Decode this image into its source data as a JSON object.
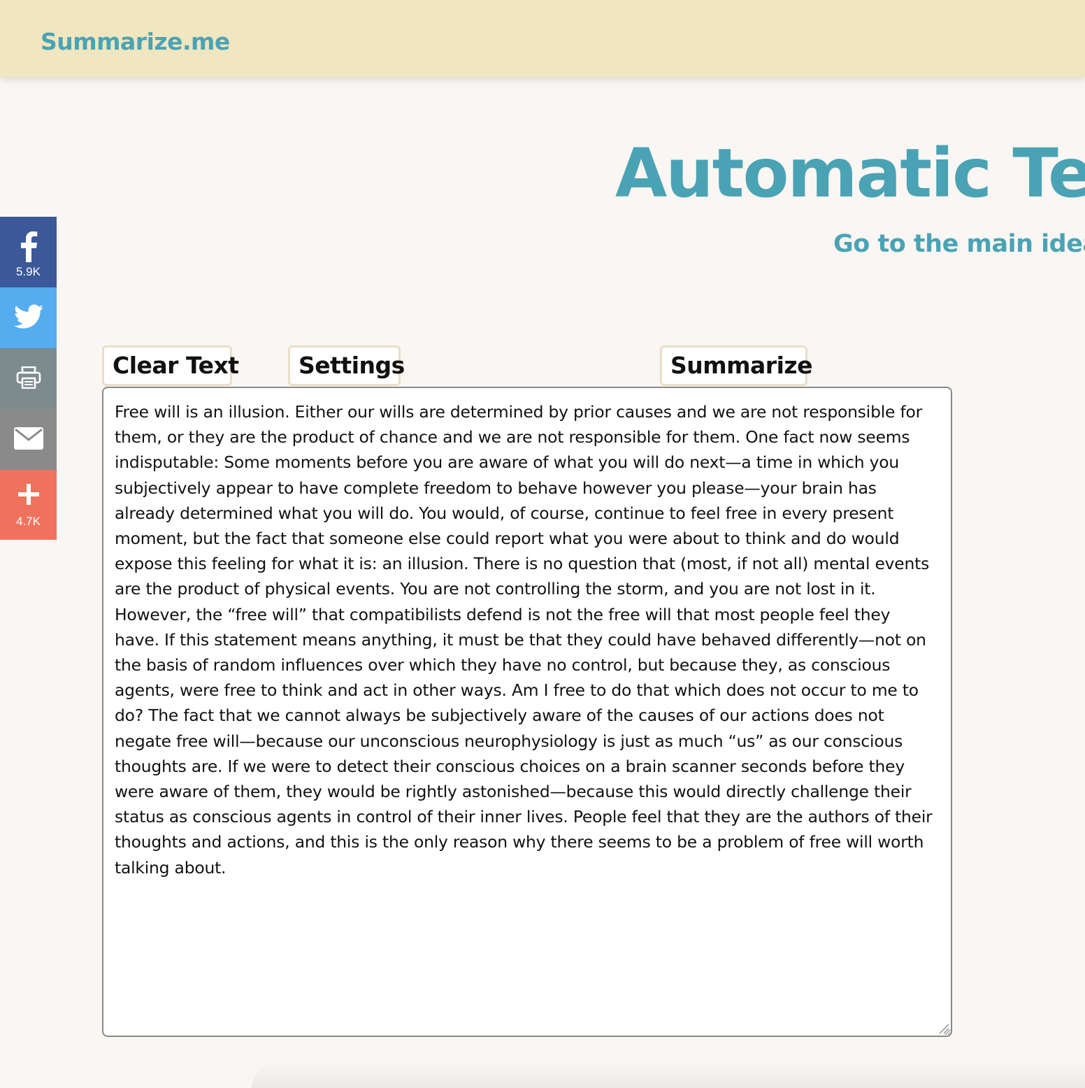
{
  "header": {
    "brand": "Summarize.me"
  },
  "hero": {
    "title": "Automatic Text",
    "subtitle": "Go to the main ideas i"
  },
  "share": {
    "facebook": {
      "icon": "facebook-icon",
      "count": "5.9K",
      "color": "#3b5998"
    },
    "twitter": {
      "icon": "twitter-icon",
      "color": "#55acee"
    },
    "print": {
      "icon": "print-icon",
      "color": "#7d8b8f"
    },
    "email": {
      "icon": "email-icon",
      "color": "#8a8a8a"
    },
    "more": {
      "icon": "plus-icon",
      "count": "4.7K",
      "color": "#ef735c"
    }
  },
  "toolbar": {
    "clear_label": "Clear Text",
    "settings_label": "Settings",
    "summarize_label": "Summarize"
  },
  "editor": {
    "value": "Free will is an illusion. Either our wills are determined by prior causes and we are not responsible for them, or they are the product of chance and we are not responsible for them. One fact now seems indisputable: Some moments before you are aware of what you will do next—a time in which you subjectively appear to have complete freedom to behave however you please—your brain has already determined what you will do. You would, of course, continue to feel free in every present moment, but the fact that someone else could report what you were about to think and do would expose this feeling for what it is: an illusion. There is no question that (most, if not all) mental events are the product of physical events. You are not controlling the storm, and you are not lost in it. However, the “free will” that compatibilists defend is not the free will that most people feel they have. If this statement means anything, it must be that they could have behaved differently—not on the basis of random influences over which they have no control, but because they, as conscious agents, were free to think and act in other ways. Am I free to do that which does not occur to me to do? The fact that we cannot always be subjectively aware of the causes of our actions does not negate free will—because our unconscious neurophysiology is just as much “us” as our conscious thoughts are. If we were to detect their conscious choices on a brain scanner seconds before they were aware of them, they would be rightly astonished—because this would directly challenge their status as conscious agents in control of their inner lives. People feel that they are the authors of their thoughts and actions, and this is the only reason why there seems to be a problem of free will worth talking about."
  },
  "colors": {
    "accent": "#4aa3b4",
    "header_bg": "#f0e6c0",
    "page_bg": "#f9f6f3"
  }
}
